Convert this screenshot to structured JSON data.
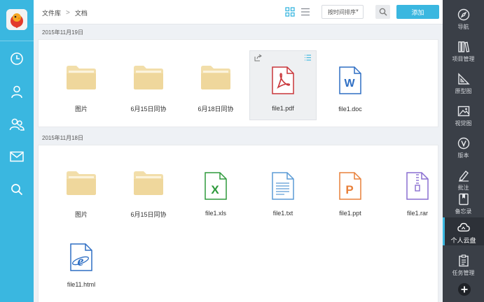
{
  "breadcrumb": {
    "root": "文件库",
    "separator": ">",
    "current": "文档"
  },
  "toolbar": {
    "sort_label": "按时间排序",
    "add_label": "添加"
  },
  "sections": [
    {
      "date": "2015年11月19日",
      "items": [
        {
          "name": "图片",
          "type": "folder"
        },
        {
          "name": "6月15日同协",
          "type": "folder"
        },
        {
          "name": "6月18日同协",
          "type": "folder"
        },
        {
          "name": "file1.pdf",
          "type": "pdf",
          "selected": true
        },
        {
          "name": "file1.doc",
          "type": "doc"
        }
      ]
    },
    {
      "date": "2015年11月18日",
      "items": [
        {
          "name": "图片",
          "type": "folder"
        },
        {
          "name": "6月15日同协",
          "type": "folder"
        },
        {
          "name": "file1.xls",
          "type": "xls"
        },
        {
          "name": "file1.txt",
          "type": "txt"
        },
        {
          "name": "file1.ppt",
          "type": "ppt"
        },
        {
          "name": "file1.rar",
          "type": "rar"
        },
        {
          "name": "file11.html",
          "type": "html"
        }
      ]
    }
  ],
  "right_nav": [
    {
      "label": "导航",
      "icon": "compass-icon"
    },
    {
      "label": "项目管理",
      "icon": "books-icon"
    },
    {
      "label": "原型图",
      "icon": "set-square-icon"
    },
    {
      "label": "视觉图",
      "icon": "image-icon"
    },
    {
      "label": "版本",
      "icon": "version-icon"
    },
    {
      "label": "批注",
      "icon": "annotate-icon"
    },
    {
      "label": "备忘录",
      "icon": "memo-icon"
    },
    {
      "label": "个人云盘",
      "icon": "cloud-icon",
      "active": true
    },
    {
      "label": "任务管理",
      "icon": "clipboard-icon"
    }
  ],
  "left_nav": [
    {
      "icon": "clock-icon"
    },
    {
      "icon": "user-icon"
    },
    {
      "icon": "contacts-icon"
    },
    {
      "icon": "mail-icon"
    },
    {
      "icon": "search-icon"
    }
  ],
  "colors": {
    "accent": "#3ab7e0",
    "sidebar_dark": "#3a3f47",
    "folder": "#f2deaa",
    "pdf": "#c9363a",
    "doc": "#2f6fc4",
    "xls": "#2e9a3c",
    "ppt": "#e8803a",
    "rar": "#8a6fd1",
    "html": "#2f6fc4"
  }
}
